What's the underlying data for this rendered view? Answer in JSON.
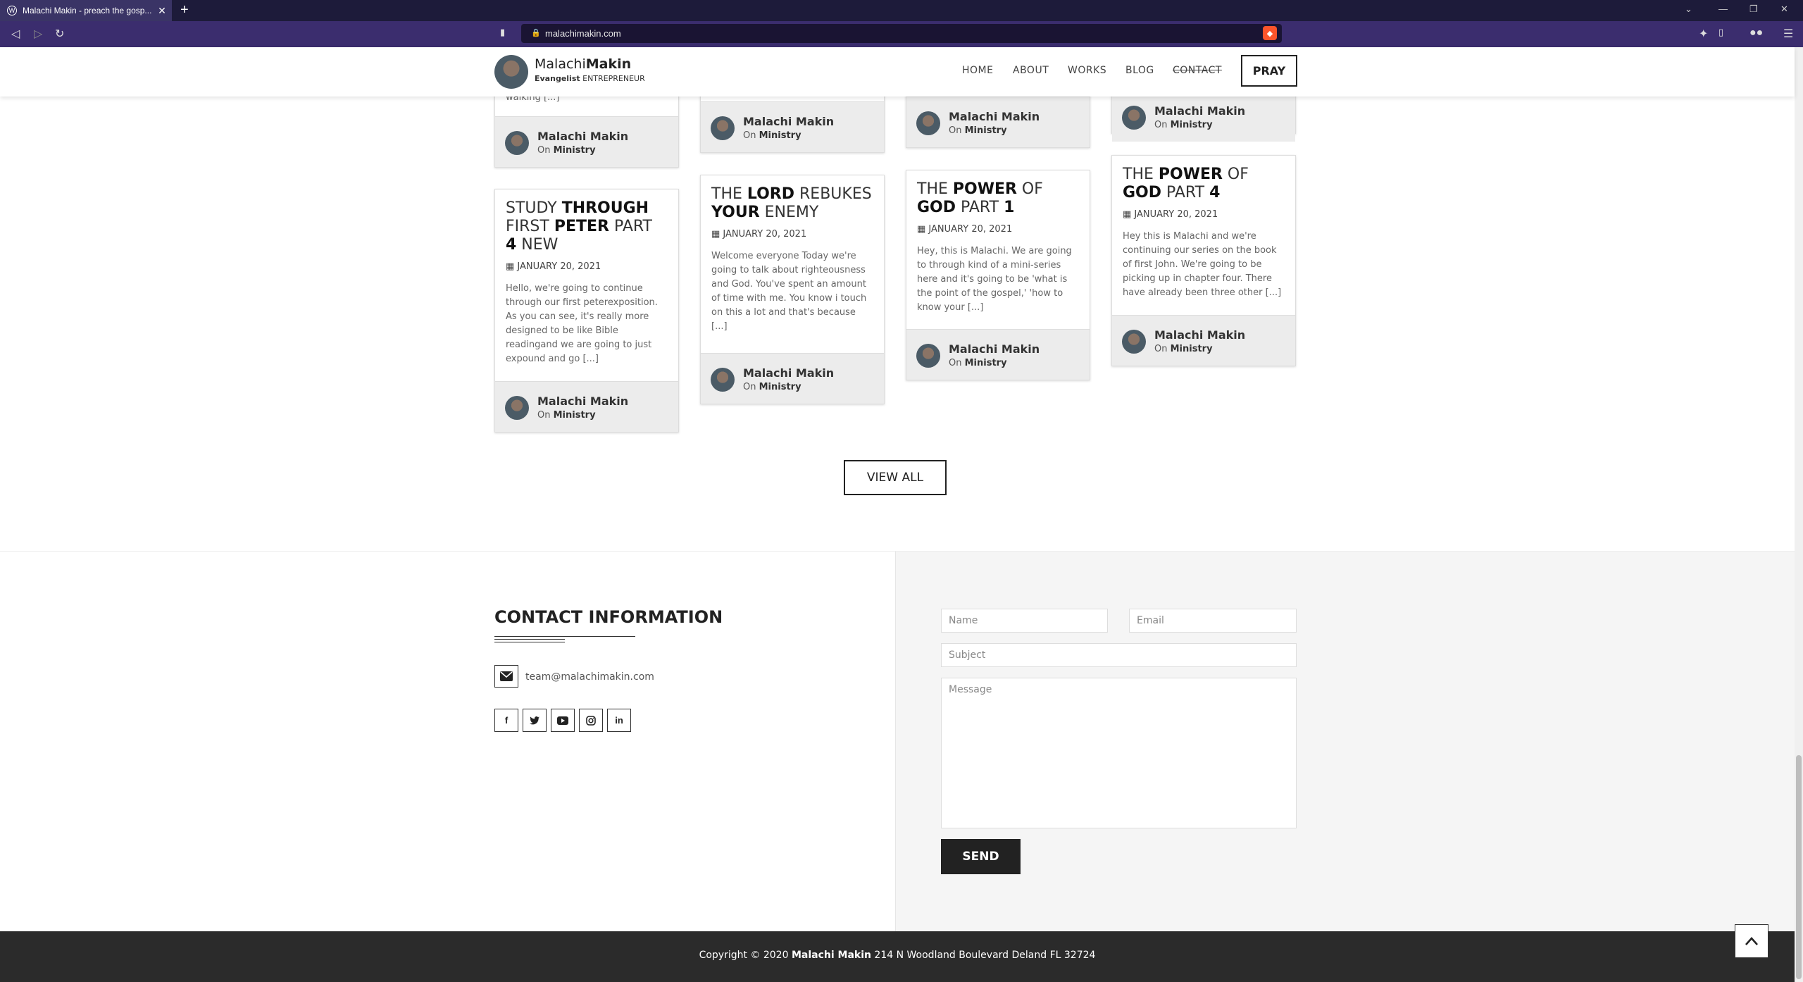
{
  "browser": {
    "tab_title": "Malachi Makin - preach the gosp...",
    "url": "malachimakin.com"
  },
  "header": {
    "logo_first": "Malachi",
    "logo_last": "Makin",
    "tag_bold": "Evangelist",
    "tag_rest": " ENTREPRENEUR",
    "nav": [
      "HOME",
      "ABOUT",
      "WORKS",
      "BLOG",
      "CONTACT"
    ],
    "pray": "PRAY"
  },
  "cards": [
    {
      "top_excerpt": "walking [...]",
      "author": "Malachi Makin",
      "on": "On ",
      "category": "Ministry"
    },
    {
      "author": "Malachi Makin",
      "on": "On ",
      "category": "Ministry"
    },
    {
      "author": "Malachi Makin",
      "on": "On ",
      "category": "Ministry"
    },
    {
      "author": "Malachi Makin",
      "on": "On ",
      "category": "Ministry"
    },
    {
      "title_parts": [
        "STUDY ",
        "THROUGH",
        " FIRST ",
        "PETER",
        " PART ",
        "4",
        " NEW"
      ],
      "date": "JANUARY 20, 2021",
      "excerpt": "Hello, we're going to continue through our first peterexposition. As you can see, it's really more designed to be like Bible readingand we are going to just expound and go [...]",
      "author": "Malachi Makin",
      "on": "On ",
      "category": "Ministry"
    },
    {
      "title_parts": [
        "THE ",
        "LORD",
        " REBUKES ",
        "YOUR",
        " ENEMY"
      ],
      "date": "JANUARY 20, 2021",
      "excerpt": "Welcome everyone Today we're going to talk about righteousness and God. You've spent an amount of time with me. You know i touch on this a lot and that's because [...]",
      "author": "Malachi Makin",
      "on": "On ",
      "category": "Ministry"
    },
    {
      "title_parts": [
        "THE ",
        "POWER",
        " OF ",
        "GOD",
        " PART ",
        "1"
      ],
      "date": "JANUARY 20, 2021",
      "excerpt": "Hey, this is Malachi. We are going to  through kind of a mini-series here and it's going to be 'what is the point of the gospel,' 'how to know your [...]",
      "author": "Malachi Makin",
      "on": "On ",
      "category": "Ministry"
    },
    {
      "title_parts": [
        "THE ",
        "POWER",
        " OF ",
        "GOD",
        " PART ",
        "4"
      ],
      "date": "JANUARY 20, 2021",
      "excerpt": "Hey this is Malachi and we're continuing our series on the book of first John. We're going to be picking up in chapter four. There have already been three other [...]",
      "author": "Malachi Makin",
      "on": "On ",
      "category": "Ministry"
    }
  ],
  "view_all": "VIEW ALL",
  "contact": {
    "title": "CONTACT INFORMATION",
    "email": "team@malachimakin.com",
    "form": {
      "name_placeholder": "Name",
      "email_placeholder": "Email",
      "subject_placeholder": "Subject",
      "message_placeholder": "Message",
      "send": "SEND"
    }
  },
  "footer": {
    "prefix": "Copyright © 2020 ",
    "name": "Malachi Makin",
    "address": " 214 N Woodland Boulevard Deland FL 32724"
  }
}
